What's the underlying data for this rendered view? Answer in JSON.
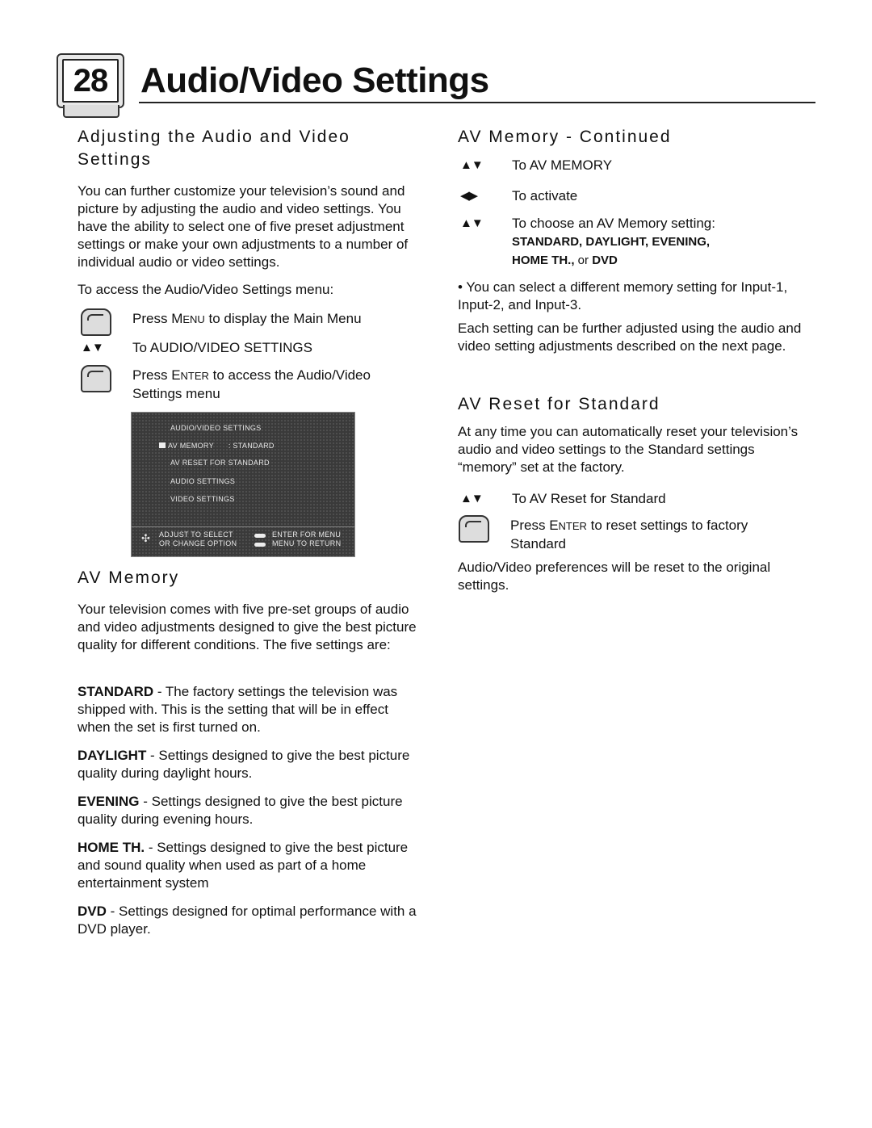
{
  "header": {
    "page_number": "28",
    "title": "Audio/Video Settings"
  },
  "left": {
    "adjusting": {
      "heading_line1": "Adjusting the Audio and Video",
      "heading_line2": "Settings",
      "intro": "You can further customize your television’s sound and picture by adjusting the audio and video settings. You have the ability to select one of five preset adjustment settings  or make your own adjustments to a number of individual audio or video settings.",
      "access_intro": "To access the Audio/Video Settings menu:",
      "steps": [
        {
          "icon": "hand-press-icon",
          "pre": "Press ",
          "key_first": "M",
          "key_rest": "ENU",
          "post": " to display the Main Menu"
        },
        {
          "icon": "up-down-arrows-icon",
          "symbol": "▲▼",
          "text": "To AUDIO/VIDEO SETTINGS"
        },
        {
          "icon": "hand-press-icon",
          "pre": "Press ",
          "key_first": "E",
          "key_rest": "NTER",
          "post": " to access the Audio/Video",
          "post2": "Settings menu"
        }
      ]
    },
    "osd": {
      "title": "AUDIO/VIDEO SETTINGS",
      "items": [
        {
          "label": "AV MEMORY",
          "value": ": STANDARD",
          "selected": true
        },
        {
          "label": "AV RESET FOR STANDARD"
        },
        {
          "label": "AUDIO SETTINGS"
        },
        {
          "label": "VIDEO SETTINGS"
        }
      ],
      "footer_left_1": "ADJUST  TO SELECT",
      "footer_left_2": "OR CHANGE OPTION",
      "footer_right_1": "ENTER FOR MENU",
      "footer_right_2": "MENU TO RETURN"
    },
    "av_memory": {
      "heading": "AV Memory",
      "intro": "Your television comes with five pre-set groups of audio and video adjustments designed to give the best picture quality for different conditions. The five settings are:",
      "settings": [
        {
          "name": "STANDARD",
          "desc": " - The factory settings the television was shipped with. This is the setting that will be in effect when the set is first turned on."
        },
        {
          "name": "DAYLIGHT",
          "desc": " - Settings designed to give the best picture quality during daylight hours."
        },
        {
          "name": "EVENING",
          "desc": " - Settings designed to give the best picture quality during evening hours."
        },
        {
          "name": "HOME TH.",
          "desc": " - Settings designed to give the best picture and sound quality when used as part of a home entertainment system"
        },
        {
          "name": "DVD",
          "desc": " - Settings designed for optimal performance with a DVD player."
        }
      ]
    }
  },
  "right": {
    "continued": {
      "heading": "AV Memory - Continued",
      "steps": [
        {
          "icon": "up-down-arrows-icon",
          "symbol": "▲▼",
          "text": "To AV MEMORY"
        },
        {
          "icon": "left-right-arrows-icon",
          "symbol": "◀▶",
          "text": "To activate"
        },
        {
          "icon": "up-down-arrows-icon",
          "symbol": "▲▼",
          "text": "To choose an AV Memory setting:",
          "options_line1": "STANDARD, DAYLIGHT, EVENING,",
          "options_line2_a": "HOME TH.,",
          "options_line2_or": " or ",
          "options_line2_b": "DVD"
        }
      ],
      "bullet": "•  You can select a different memory setting for Input-1, Input-2, and Input-3.",
      "note": "Each setting can be further adjusted using the audio and video setting adjustments described on the next page."
    },
    "reset": {
      "heading": "AV Reset for Standard",
      "intro": "At any time you can automatically reset your television’s audio and video settings to the Standard settings “memory” set at the factory.",
      "steps": [
        {
          "icon": "up-down-arrows-icon",
          "symbol": "▲▼",
          "text": "To AV Reset for Standard"
        },
        {
          "icon": "hand-press-icon",
          "pre": "Press ",
          "key_first": "E",
          "key_rest": "NTER",
          "post": " to reset settings to factory",
          "post2": "Standard"
        }
      ],
      "outro": "Audio/Video preferences will be reset to the original settings."
    }
  }
}
